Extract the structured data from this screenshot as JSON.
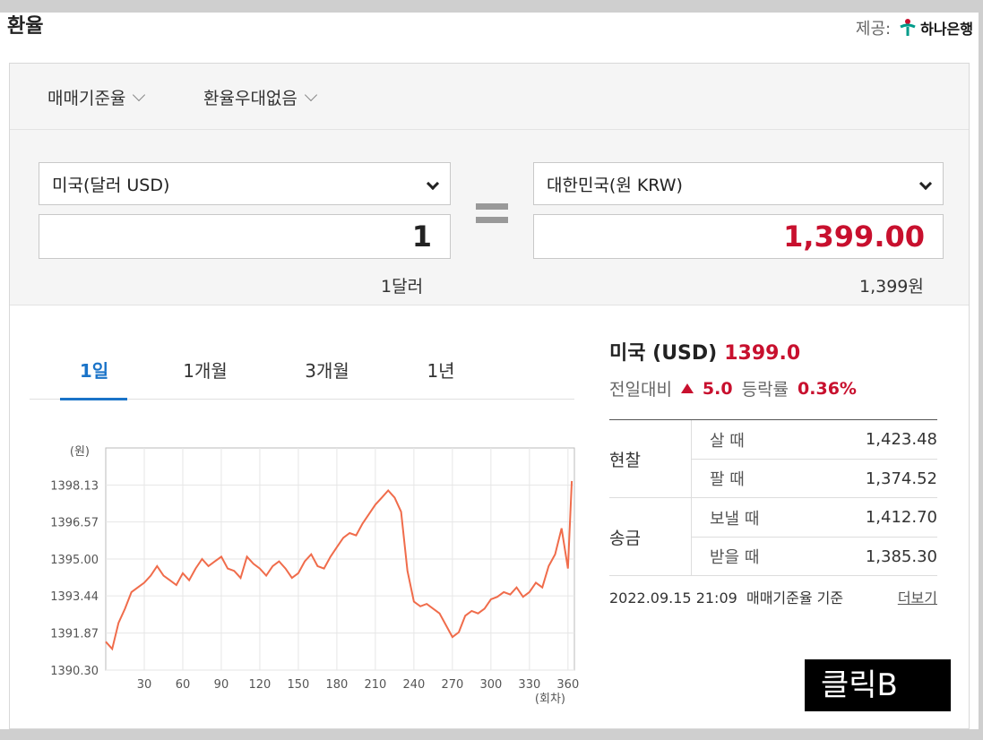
{
  "title": "환율",
  "provider": {
    "label": "제공:",
    "bank": "하나은행"
  },
  "options": {
    "rate_type": "매매기준율",
    "preferential": "환율우대없음"
  },
  "from": {
    "currency": "미국(달러 USD)",
    "amount": "1",
    "caption": "1달러"
  },
  "to": {
    "currency": "대한민국(원 KRW)",
    "amount": "1,399.00",
    "caption": "1,399원"
  },
  "tabs": [
    "1일",
    "1개월",
    "3개월",
    "1년"
  ],
  "info": {
    "name": "미국 (USD)",
    "rate": "1399.0",
    "change_label": "전일대비",
    "change": "5.0",
    "pct_label": "등락률",
    "pct": "0.36%"
  },
  "rates": {
    "cash": {
      "label": "현찰",
      "buy_label": "살 때",
      "buy": "1,423.48",
      "sell_label": "팔 때",
      "sell": "1,374.52"
    },
    "remit": {
      "label": "송금",
      "send_label": "보낼 때",
      "send": "1,412.70",
      "recv_label": "받을 때",
      "recv": "1,385.30"
    }
  },
  "footer": {
    "timestamp": "2022.09.15 21:09",
    "basis": "매매기준율 기준",
    "more": "더보기"
  },
  "overlay_button": "클릭B",
  "colors": {
    "accent_blue": "#1a73c8",
    "up_red": "#c8102e",
    "line": "#f06c4b"
  },
  "chart_data": {
    "type": "line",
    "ylabel": "(원)",
    "xlabel": "(회차)",
    "yticks": [
      "1398.13",
      "1396.57",
      "1395.00",
      "1393.44",
      "1391.87",
      "1390.30"
    ],
    "xticks": [
      "30",
      "60",
      "90",
      "120",
      "150",
      "180",
      "210",
      "240",
      "270",
      "300",
      "330",
      "360"
    ],
    "xlim": [
      0,
      365
    ],
    "ylim": [
      1390.3,
      1399.7
    ],
    "x": [
      0,
      5,
      10,
      15,
      20,
      25,
      30,
      35,
      40,
      45,
      50,
      55,
      60,
      65,
      70,
      75,
      80,
      85,
      90,
      95,
      100,
      105,
      110,
      115,
      120,
      125,
      130,
      135,
      140,
      145,
      150,
      155,
      160,
      165,
      170,
      175,
      180,
      185,
      190,
      195,
      200,
      205,
      210,
      215,
      220,
      225,
      230,
      235,
      240,
      245,
      250,
      255,
      260,
      265,
      270,
      275,
      280,
      285,
      290,
      295,
      300,
      305,
      310,
      315,
      320,
      325,
      330,
      335,
      340,
      345,
      350,
      355,
      360,
      363
    ],
    "y": [
      1391.5,
      1391.2,
      1392.3,
      1392.9,
      1393.6,
      1393.8,
      1394.0,
      1394.3,
      1394.7,
      1394.3,
      1394.1,
      1393.9,
      1394.4,
      1394.1,
      1394.6,
      1395.0,
      1394.7,
      1394.9,
      1395.1,
      1394.6,
      1394.5,
      1394.2,
      1395.1,
      1394.8,
      1394.6,
      1394.3,
      1394.7,
      1394.9,
      1394.6,
      1394.2,
      1394.4,
      1394.9,
      1395.2,
      1394.7,
      1394.6,
      1395.1,
      1395.5,
      1395.9,
      1396.1,
      1396.0,
      1396.5,
      1396.9,
      1397.3,
      1397.6,
      1397.9,
      1397.6,
      1397.0,
      1394.5,
      1393.2,
      1393.0,
      1393.1,
      1392.9,
      1392.7,
      1392.2,
      1391.7,
      1391.9,
      1392.6,
      1392.8,
      1392.7,
      1392.9,
      1393.3,
      1393.4,
      1393.6,
      1393.5,
      1393.8,
      1393.4,
      1393.6,
      1394.0,
      1393.8,
      1394.7,
      1395.2,
      1396.3,
      1394.6,
      1398.3
    ]
  }
}
